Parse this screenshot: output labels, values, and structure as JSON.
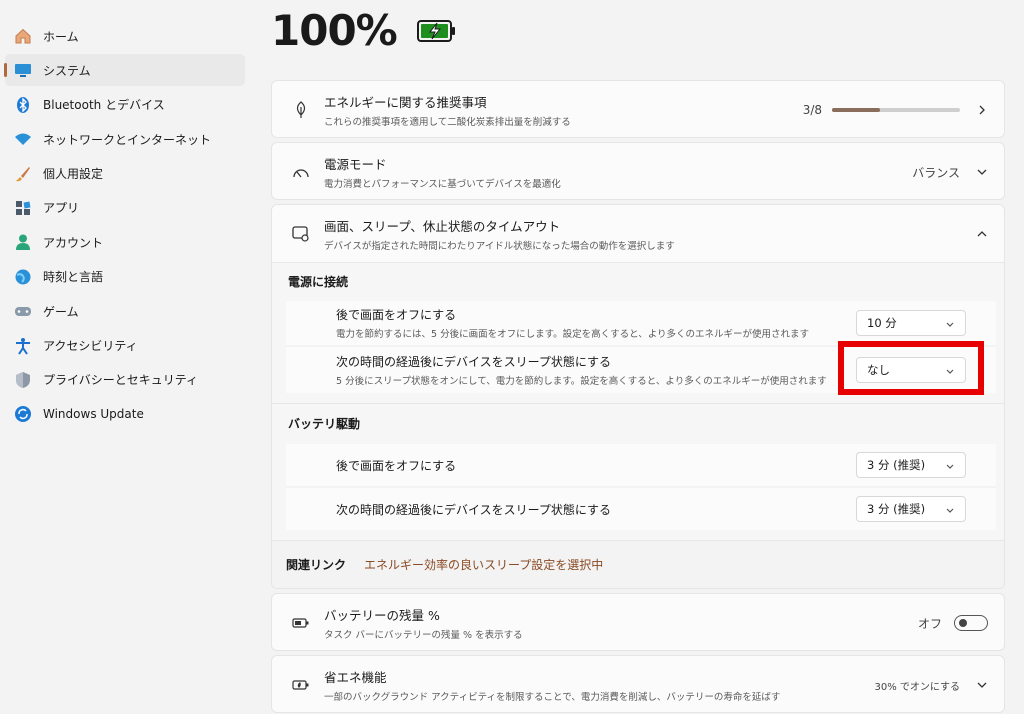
{
  "sidebar": {
    "items": [
      {
        "label": "ホーム",
        "icon": "home-icon"
      },
      {
        "label": "システム",
        "icon": "system-icon"
      },
      {
        "label": "Bluetooth とデバイス",
        "icon": "bluetooth-icon"
      },
      {
        "label": "ネットワークとインターネット",
        "icon": "wifi-icon"
      },
      {
        "label": "個人用設定",
        "icon": "brush-icon"
      },
      {
        "label": "アプリ",
        "icon": "apps-icon"
      },
      {
        "label": "アカウント",
        "icon": "account-icon"
      },
      {
        "label": "時刻と言語",
        "icon": "globe-icon"
      },
      {
        "label": "ゲーム",
        "icon": "gamepad-icon"
      },
      {
        "label": "アクセシビリティ",
        "icon": "accessibility-icon"
      },
      {
        "label": "プライバシーとセキュリティ",
        "icon": "shield-icon"
      },
      {
        "label": "Windows Update",
        "icon": "update-icon"
      }
    ]
  },
  "battery": {
    "percent": "100%",
    "charging": true
  },
  "energy": {
    "title": "エネルギーに関する推奨事項",
    "desc": "これらの推奨事項を適用して二酸化炭素排出量を削減する",
    "progress_label": "3/8",
    "progress_fraction": 0.375
  },
  "power_mode": {
    "title": "電源モード",
    "desc": "電力消費とパフォーマンスに基づいてデバイスを最適化",
    "value": "バランス"
  },
  "timeout": {
    "title": "画面、スリープ、休止状態のタイムアウト",
    "desc": "デバイスが指定された時間にわたりアイドル状態になった場合の動作を選択します",
    "plugged": {
      "heading": "電源に接続",
      "screen_off_title": "後で画面をオフにする",
      "screen_off_desc": "電力を節約するには、5 分後に画面をオフにします。設定を高くすると、より多くのエネルギーが使用されます",
      "screen_off_value": "10 分",
      "sleep_title": "次の時間の経過後にデバイスをスリープ状態にする",
      "sleep_desc": "5 分後にスリープ状態をオンにして、電力を節約します。設定を高くすると、より多くのエネルギーが使用されます",
      "sleep_value": "なし"
    },
    "battery": {
      "heading": "バッテリ駆動",
      "screen_off_title": "後で画面をオフにする",
      "screen_off_value": "3 分 (推奨)",
      "sleep_title": "次の時間の経過後にデバイスをスリープ状態にする",
      "sleep_value": "3 分 (推奨)"
    }
  },
  "related": {
    "label": "関連リンク",
    "link": "エネルギー効率の良いスリープ設定を選択中"
  },
  "battery_pct_setting": {
    "title": "バッテリーの残量 %",
    "desc": "タスク バーにバッテリーの残量 % を表示する",
    "toggle_label": "オフ",
    "toggle_on": false
  },
  "saver": {
    "title": "省エネ機能",
    "desc": "一部のバックグラウンド アクティビティを制限することで、電力消費を削減し、バッテリーの寿命を延ばす",
    "value": "30% でオンにする"
  },
  "colors": {
    "accent": "#b26a3c",
    "highlight": "#e60000",
    "battery_green": "#1e8e1e"
  }
}
